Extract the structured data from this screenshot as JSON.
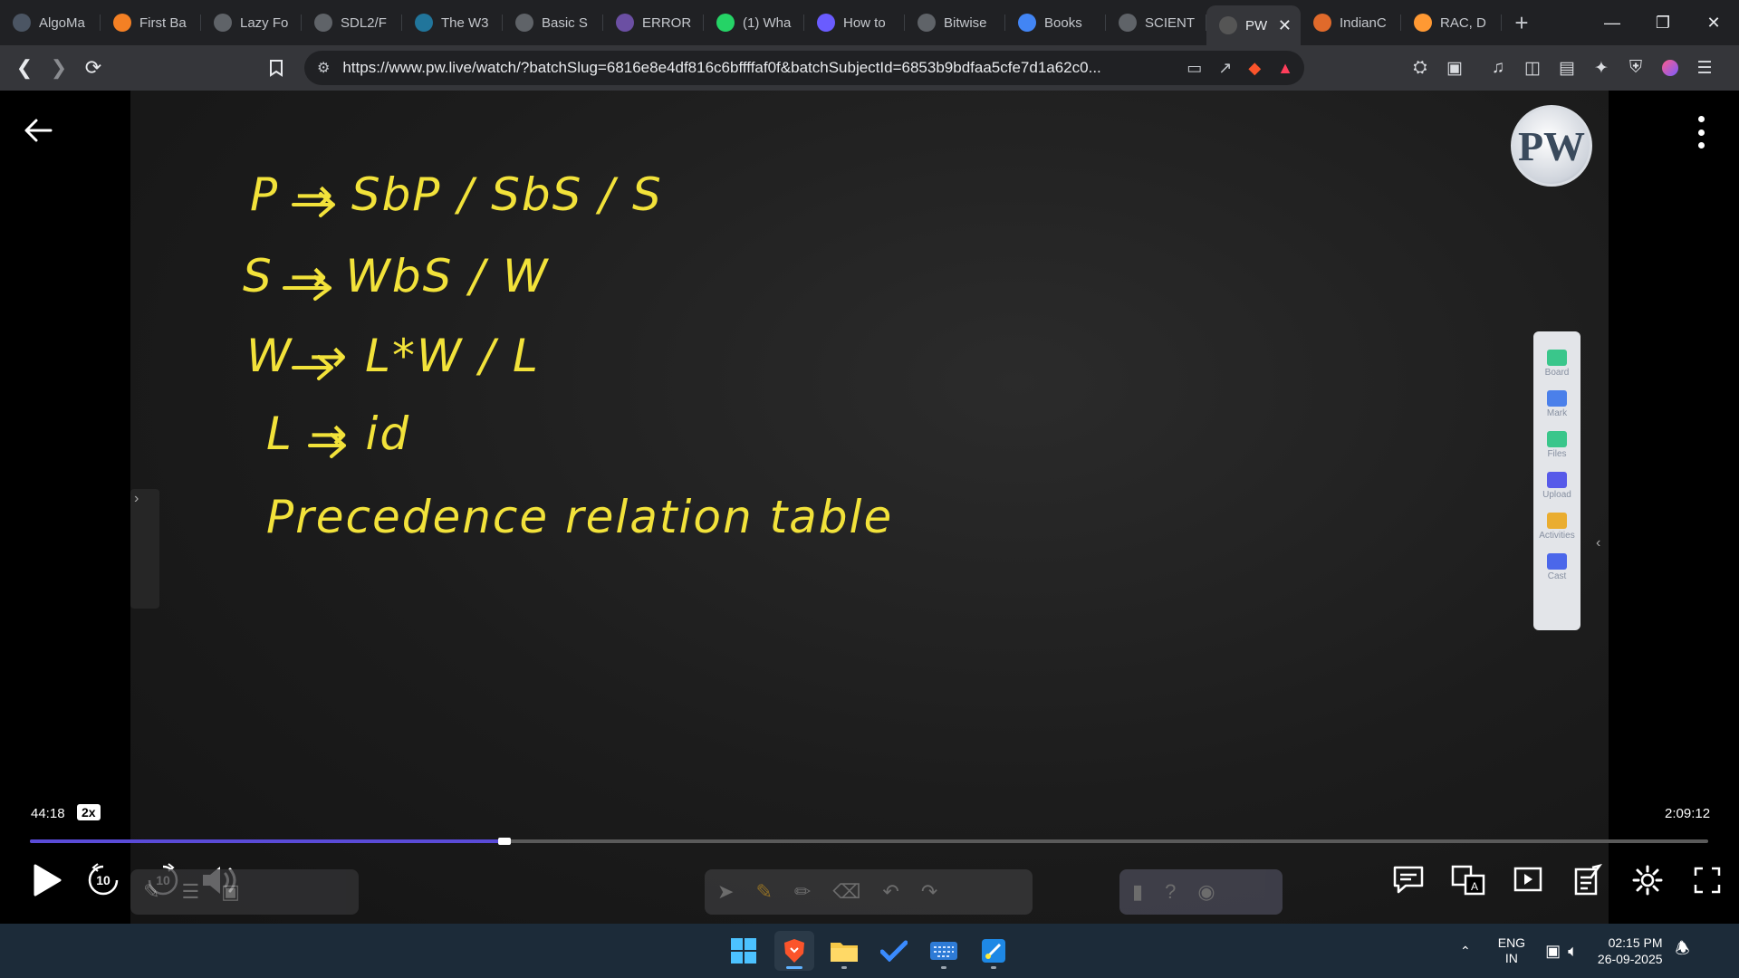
{
  "browser": {
    "tabs": [
      {
        "label": "AlgoMa",
        "icon": "algomaster-icon",
        "color": "#4b5563"
      },
      {
        "label": "First Ba",
        "icon": "stack-icon",
        "color": "#f48024"
      },
      {
        "label": "Lazy Fo",
        "icon": "globe-icon",
        "color": "#5f6368"
      },
      {
        "label": "SDL2/F",
        "icon": "globe-icon",
        "color": "#5f6368"
      },
      {
        "label": "The W3",
        "icon": "wordpress-icon",
        "color": "#21759b"
      },
      {
        "label": "Basic S",
        "icon": "image-icon",
        "color": "#5f6368"
      },
      {
        "label": "ERROR",
        "icon": "error-site-icon",
        "color": "#6b4fa3"
      },
      {
        "label": "(1) Wha",
        "icon": "whatsapp-icon",
        "color": "#25d366"
      },
      {
        "label": "How to",
        "icon": "vscode-icon",
        "color": "#6a5cff"
      },
      {
        "label": "Bitwise",
        "icon": "bitwise-icon",
        "color": "#5f6368"
      },
      {
        "label": "Books",
        "icon": "google-icon",
        "color": "#4285f4"
      },
      {
        "label": "SCIENT",
        "icon": "globe-icon",
        "color": "#5f6368"
      },
      {
        "label": "PW",
        "icon": "pw-icon",
        "color": "#555555",
        "active": true
      },
      {
        "label": "IndianC",
        "icon": "indianc-icon",
        "color": "#e06a2b"
      },
      {
        "label": "RAC, D",
        "icon": "india-flag-icon",
        "color": "#ff9933"
      }
    ],
    "url": "https://www.pw.live/watch/?batchSlug=6816e8e4df816c6bffffaf0f&batchSubjectId=6853b9bdfaa5cfe7d1a62c0..."
  },
  "player": {
    "board_text": {
      "rule1": "P → SbP / SbS / S",
      "rule2": "S → WbS / W",
      "rule3": "W → L*W / L",
      "rule4": "L → id",
      "caption": "Precedence relation table"
    },
    "current_time": "44:18",
    "speed": "2x",
    "total_time": "2:09:12",
    "progress": 0.283,
    "rewind_label": "10",
    "forward_label": "10",
    "logo_text": "PW",
    "side_toolbar": [
      {
        "label": "Board",
        "color": "#3ccf91"
      },
      {
        "label": "Mark",
        "color": "#4e86f5"
      },
      {
        "label": "Files",
        "color": "#3ccf91"
      },
      {
        "label": "Upload",
        "color": "#5b5ef4"
      },
      {
        "label": "Activities",
        "color": "#f5b531"
      },
      {
        "label": "Cast",
        "color": "#4e6bf5"
      }
    ]
  },
  "taskbar": {
    "lang_line1": "ENG",
    "lang_line2": "IN",
    "time": "02:15 PM",
    "date": "26-09-2025"
  }
}
